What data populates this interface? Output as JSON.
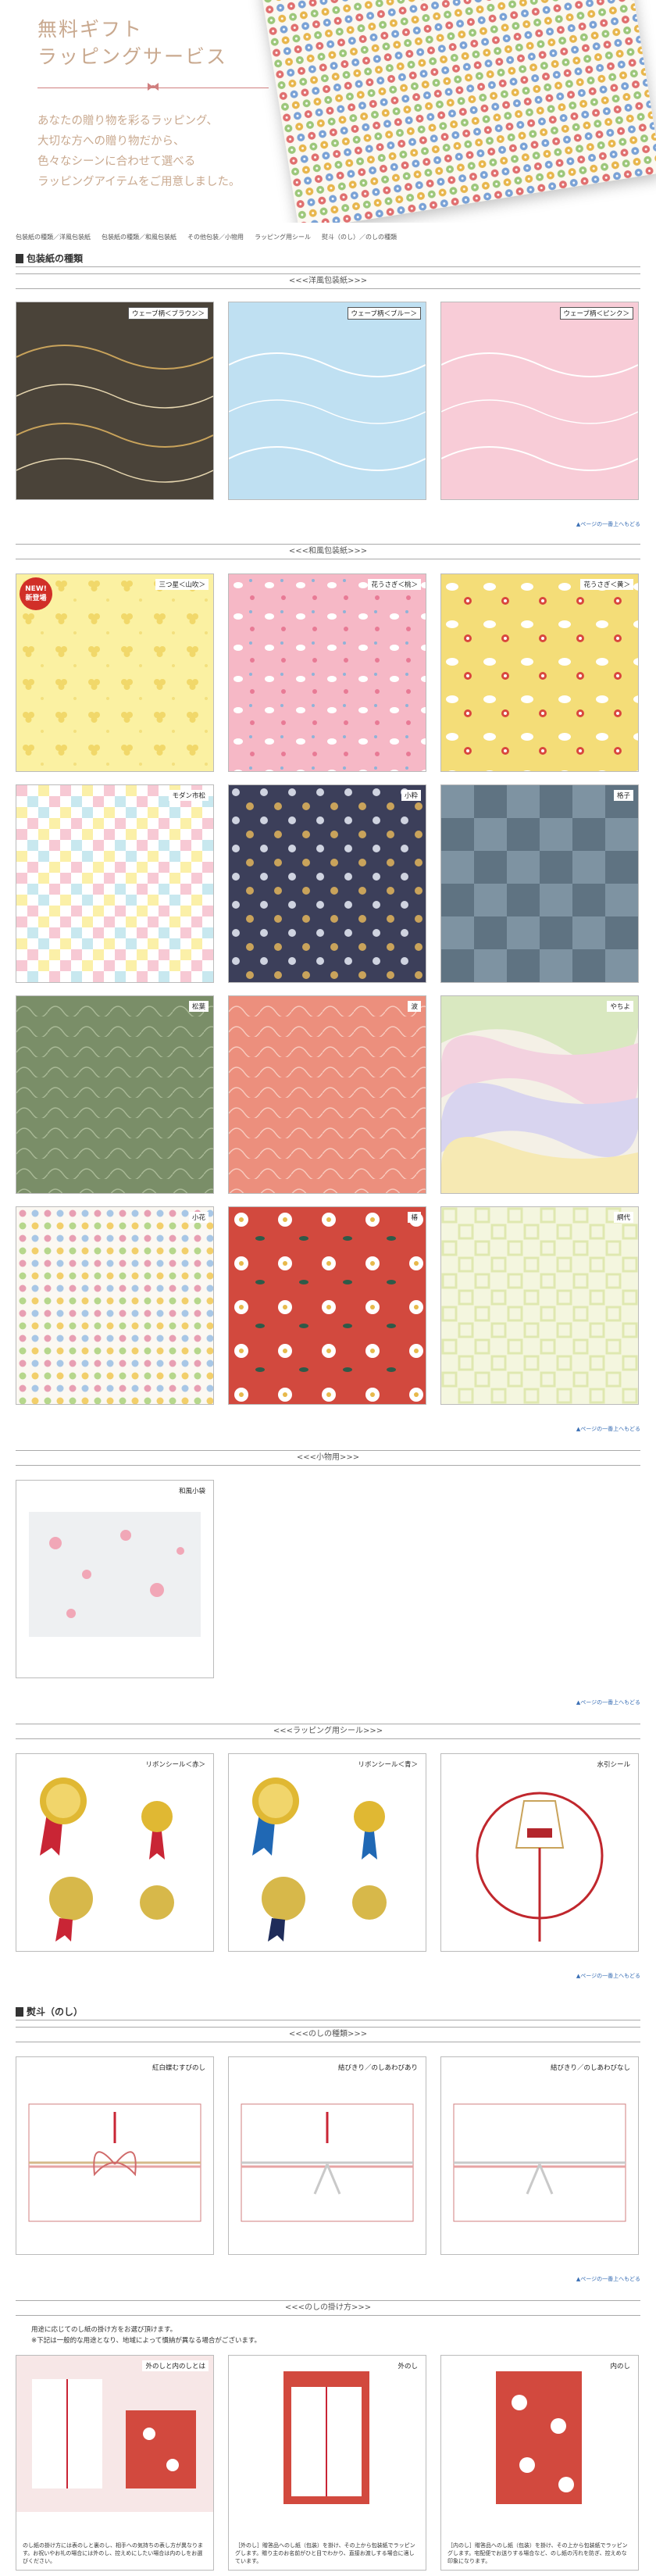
{
  "hero": {
    "title_line1": "無料ギフト",
    "title_line2": "ラッピングサービス",
    "text_lines": [
      "あなたの贈り物を彩るラッピング、",
      "大切な方への贈り物だから、",
      "色々なシーンに合わせて選べる",
      "ラッピングアイテムをご用意しました。"
    ]
  },
  "breadcrumb": [
    "包装紙の種類／洋風包装紙",
    "包装紙の種類／和風包装紙",
    "その他包装／小物用",
    "ラッピング用シール",
    "熨斗（のし）／のしの種類"
  ],
  "sections": {
    "wrapping_title": "包装紙の種類",
    "western_sub": "<<<洋風包装紙>>>",
    "japanese_sub": "<<<和風包装紙>>>",
    "small_sub": "<<<小物用>>>",
    "seal_sub": "<<<ラッピング用シール>>>",
    "noshi_title": "熨斗（のし）",
    "noshi_kind_sub": "<<<のしの種類>>>",
    "noshi_how_sub": "<<<のしの掛け方>>>"
  },
  "pagetop": "▲ページの一番上へもどる",
  "new_badge": {
    "line1": "NEW!",
    "line2": "新登場"
  },
  "western": [
    "ウェーブ柄＜ブラウン＞",
    "ウェーブ柄＜ブルー＞",
    "ウェーブ柄＜ピンク＞"
  ],
  "japanese": [
    "三つ星＜山吹＞",
    "花うさぎ＜桃＞",
    "花うさぎ＜黄＞",
    "モダン市松",
    "小粋",
    "格子",
    "松葉",
    "波",
    "やちよ",
    "小花",
    "椿",
    "網代"
  ],
  "small": [
    "和風小袋"
  ],
  "seals": [
    "リボンシール＜赤＞",
    "リボンシール＜青＞",
    "水引シール"
  ],
  "noshi_kinds": [
    "紅白蝶むすびのし",
    "結びきり／のしあわびあり",
    "結びきり／のしあわびなし"
  ],
  "noshi_how_notes": [
    "用途に応じてのし紙の掛け方をお選び頂けます。",
    "※下記は一般的な用途となり、地域によって慣納が異なる場合がございます。"
  ],
  "noshi_how": [
    {
      "label": "外のしと内のしとは",
      "desc": "のし紙の掛け方には表のしと裏のし、相手への気持ちの表し方が異なります。お祝いやお礼の場合には外のし、控えめにしたい場合は内のしをお選びください。"
    },
    {
      "label": "外のし",
      "desc": "［外のし］贈答品へのし紙（包装）を掛け、その上から包装紙でラッピングします。贈り主のお名前がひと目でわかり、直接お渡しする場合に適しています。"
    },
    {
      "label": "内のし",
      "desc": "［内のし］贈答品へのし紙（包装）を掛け、その上から包装紙でラッピングします。宅配便でお送りする場合など、のし紙の汚れを防ぎ、控えめな印象になります。"
    }
  ],
  "colors": {
    "accent": "#c9a98f",
    "rule": "#d07f7f",
    "link": "#3a6fb5"
  }
}
